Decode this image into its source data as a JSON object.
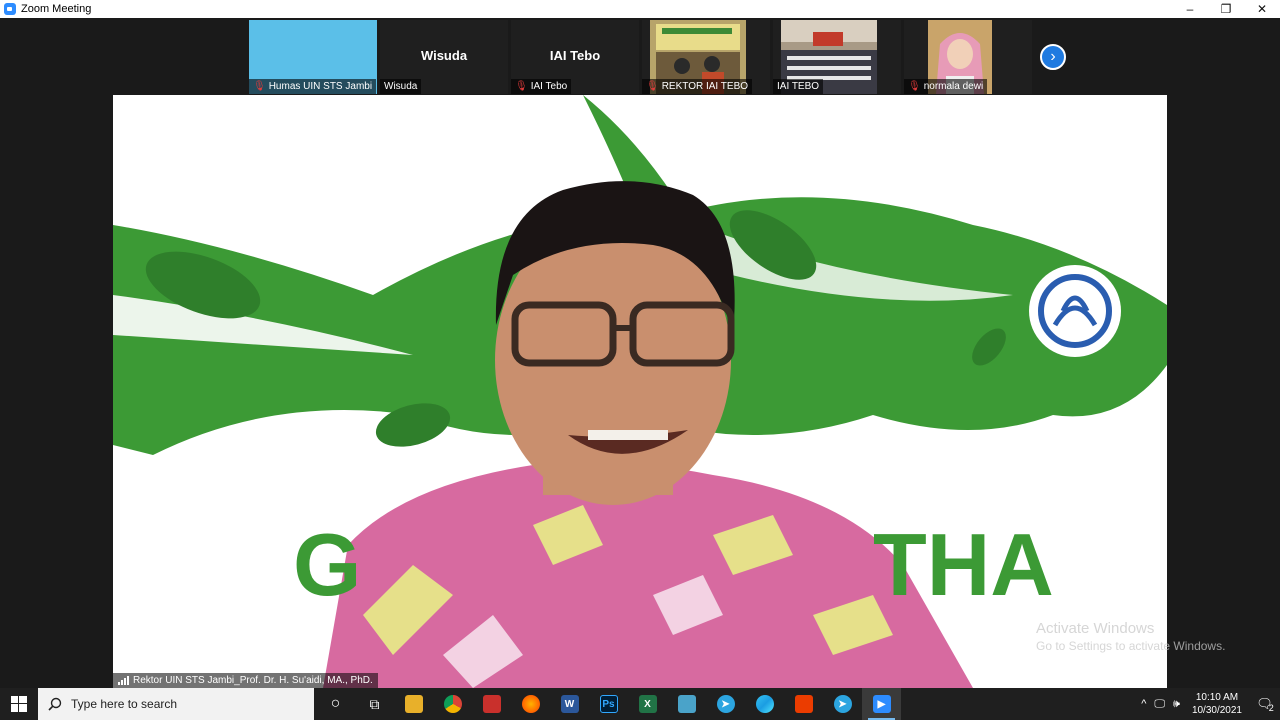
{
  "window": {
    "title": "Zoom Meeting",
    "controls": {
      "minimize": "–",
      "restore": "❐",
      "close": "✕"
    }
  },
  "thumbnails": [
    {
      "name": "Humas UIN STS Jambi",
      "muted": true,
      "title": ""
    },
    {
      "name": "Wisuda",
      "muted": false,
      "title": "Wisuda"
    },
    {
      "name": "IAI Tebo",
      "muted": true,
      "title": "IAI Tebo"
    },
    {
      "name": "REKTOR IAI TEBO",
      "muted": true,
      "title": ""
    },
    {
      "name": "IAI TEBO",
      "muted": false,
      "title": ""
    },
    {
      "name": "normala dewi",
      "muted": true,
      "title": ""
    }
  ],
  "next_page_icon": "›",
  "main_video": {
    "speaker_name": "Rektor UIN STS Jambi_Prof. Dr. H. Su'aidi, MA., PhD.",
    "background_text": "THA",
    "background_text_left": "G"
  },
  "watermark": {
    "line1": "Activate Windows",
    "line2": "Go to Settings to activate Windows."
  },
  "taskbar": {
    "search_placeholder": "Type here to search",
    "apps": [
      {
        "id": "cortana",
        "label": "○",
        "color": "#1f1f1f"
      },
      {
        "id": "task-view",
        "label": "⧉",
        "color": "#1f1f1f"
      },
      {
        "id": "file-explorer",
        "label": "📁",
        "color": "#e8b02a"
      },
      {
        "id": "chrome",
        "label": "",
        "color": "#db4437"
      },
      {
        "id": "app-red",
        "label": "",
        "color": "#c9302c"
      },
      {
        "id": "firefox",
        "label": "",
        "color": "#ff7139"
      },
      {
        "id": "word",
        "label": "W",
        "color": "#2b579a"
      },
      {
        "id": "photoshop",
        "label": "Ps",
        "color": "#001e36"
      },
      {
        "id": "excel",
        "label": "X",
        "color": "#217346"
      },
      {
        "id": "app-teal",
        "label": "",
        "color": "#4aa3c9"
      },
      {
        "id": "telegram",
        "label": "➤",
        "color": "#2ca5e0"
      },
      {
        "id": "edge",
        "label": "",
        "color": "#1fa0c8"
      },
      {
        "id": "office",
        "label": "",
        "color": "#eb3c00"
      },
      {
        "id": "telegram-2",
        "label": "➤",
        "color": "#2ca5e0"
      },
      {
        "id": "zoom",
        "label": "▶",
        "color": "#2d8cff",
        "active": true
      }
    ],
    "tray": {
      "up_arrow": "^",
      "network": "🖵",
      "volume": "🕪",
      "time": "10:10 AM",
      "date": "10/30/2021",
      "notifications": "2"
    }
  },
  "colors": {
    "zoom_blue": "#2d8cff",
    "muted_red": "#e23b3b",
    "fish_green": "#3c9a35"
  }
}
